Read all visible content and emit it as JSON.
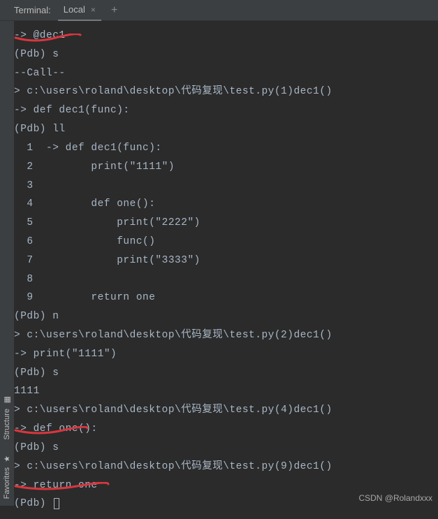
{
  "header": {
    "terminal_label": "Terminal:",
    "tab_name": "Local"
  },
  "sidebar": {
    "structure_label": "Structure",
    "favorites_label": "Favorites"
  },
  "terminal": {
    "lines": [
      "-> @dec1",
      "(Pdb) s",
      "--Call--",
      "> c:\\users\\roland\\desktop\\代码复现\\test.py(1)dec1()",
      "-> def dec1(func):",
      "(Pdb) ll",
      "  1  -> def dec1(func):",
      "  2         print(\"1111\")",
      "  3",
      "  4         def one():",
      "  5             print(\"2222\")",
      "  6             func()",
      "  7             print(\"3333\")",
      "  8",
      "  9         return one",
      "(Pdb) n",
      "> c:\\users\\roland\\desktop\\代码复现\\test.py(2)dec1()",
      "-> print(\"1111\")",
      "(Pdb) s",
      "1111",
      "> c:\\users\\roland\\desktop\\代码复现\\test.py(4)dec1()",
      "-> def one():",
      "(Pdb) s",
      "> c:\\users\\roland\\desktop\\代码复现\\test.py(9)dec1()",
      "-> return one",
      "(Pdb) "
    ]
  },
  "watermark": "CSDN @Rolandxxx"
}
